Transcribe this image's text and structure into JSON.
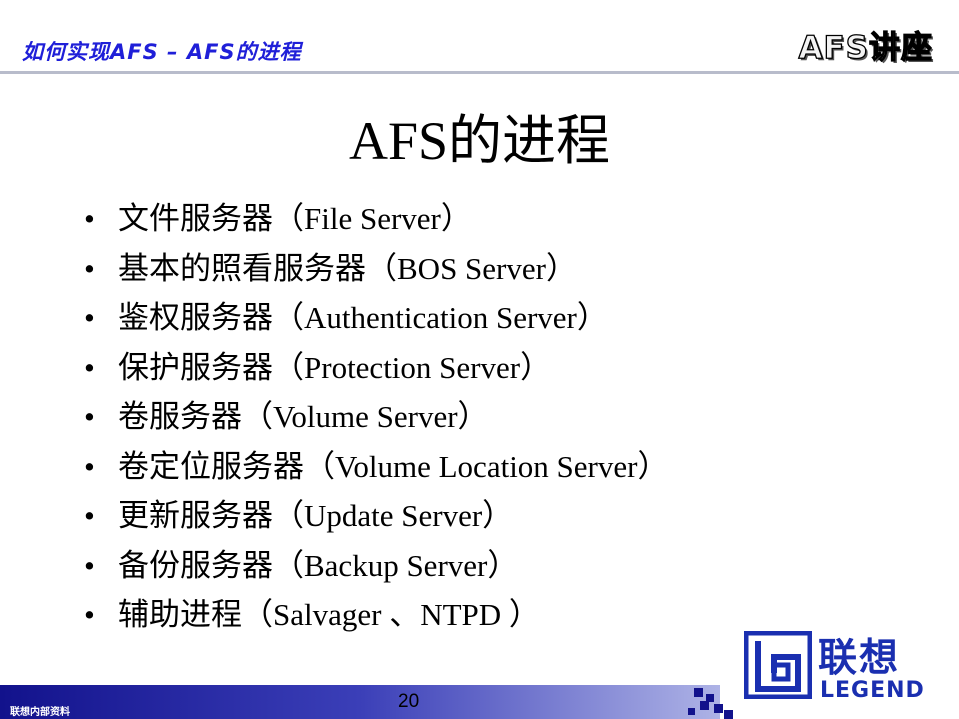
{
  "header": {
    "title": "如何实现AFS – AFS的进程",
    "series_label": "AFS讲座",
    "accent_color": "#1f1fd8"
  },
  "slide": {
    "title": "AFS的进程",
    "bullets": [
      "文件服务器（File Server）",
      "基本的照看服务器（BOS Server）",
      "鉴权服务器（Authentication Server）",
      "保护服务器（Protection Server）",
      "卷服务器（Volume Server）",
      "卷定位服务器（Volume Location Server）",
      "更新服务器（Update Server）",
      "备份服务器（Backup Server）",
      "辅助进程（Salvager 、NTPD ）"
    ],
    "bullet_symbol": "•"
  },
  "logo": {
    "name_cn": "联想",
    "name_en": "LEGEND",
    "brand_color": "#1a2fb0"
  },
  "footer": {
    "label": "联想内部资料",
    "page_number": "20",
    "bar_color": "#12128c"
  }
}
